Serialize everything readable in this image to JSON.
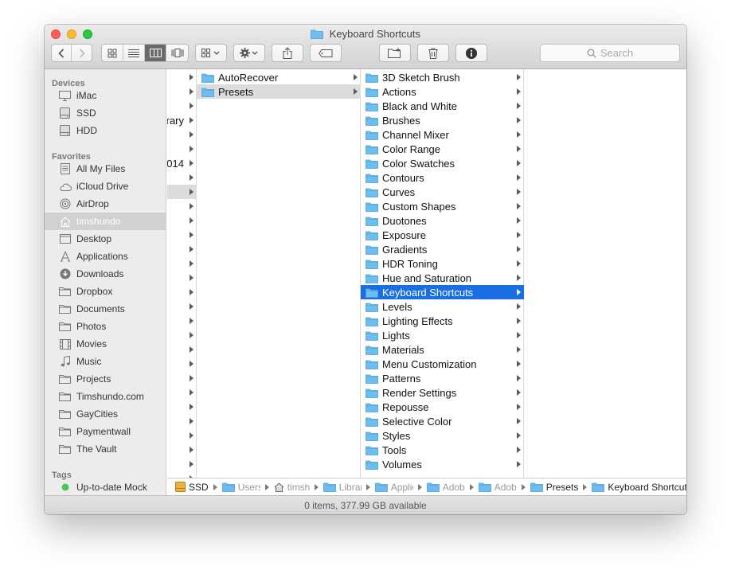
{
  "window": {
    "title": "Keyboard Shortcuts"
  },
  "toolbar": {
    "search_placeholder": "Search"
  },
  "sidebar": {
    "sections": [
      {
        "title": "Devices",
        "items": [
          {
            "label": "iMac",
            "icon": "imac-icon"
          },
          {
            "label": "SSD",
            "icon": "drive-icon"
          },
          {
            "label": "HDD",
            "icon": "drive-icon"
          }
        ]
      },
      {
        "title": "Favorites",
        "items": [
          {
            "label": "All My Files",
            "icon": "all-files-icon"
          },
          {
            "label": "iCloud Drive",
            "icon": "cloud-icon"
          },
          {
            "label": "AirDrop",
            "icon": "airdrop-icon"
          },
          {
            "label": "timshundo",
            "icon": "home-icon",
            "selected": true
          },
          {
            "label": "Desktop",
            "icon": "desktop-icon"
          },
          {
            "label": "Applications",
            "icon": "applications-icon"
          },
          {
            "label": "Downloads",
            "icon": "downloads-icon"
          },
          {
            "label": "Dropbox",
            "icon": "folder-icon"
          },
          {
            "label": "Documents",
            "icon": "folder-icon"
          },
          {
            "label": "Photos",
            "icon": "folder-icon"
          },
          {
            "label": "Movies",
            "icon": "movies-icon"
          },
          {
            "label": "Music",
            "icon": "music-icon"
          },
          {
            "label": "Projects",
            "icon": "folder-icon"
          },
          {
            "label": "Timshundo.com",
            "icon": "folder-icon"
          },
          {
            "label": "GayCities",
            "icon": "folder-icon"
          },
          {
            "label": "Paymentwall",
            "icon": "folder-icon"
          },
          {
            "label": "The Vault",
            "icon": "folder-icon"
          }
        ]
      },
      {
        "title": "Tags",
        "items": [
          {
            "label": "Up-to-date Mock",
            "icon": "green-tag-icon"
          }
        ]
      }
    ]
  },
  "columns": {
    "col0": [
      "",
      "",
      "",
      "rary",
      "",
      "",
      "014",
      "",
      "",
      "",
      "",
      "",
      "",
      "",
      "",
      "",
      "",
      "",
      "",
      "",
      "",
      "",
      "",
      "",
      "",
      "",
      "",
      "",
      ""
    ],
    "col1": [
      "AutoRecover",
      "Presets"
    ],
    "col2": [
      "3D Sketch Brush",
      "Actions",
      "Black and White",
      "Brushes",
      "Channel Mixer",
      "Color Range",
      "Color Swatches",
      "Contours",
      "Curves",
      "Custom Shapes",
      "Duotones",
      "Exposure",
      "Gradients",
      "HDR Toning",
      "Hue and Saturation",
      "Keyboard Shortcuts",
      "Levels",
      "Lighting Effects",
      "Lights",
      "Materials",
      "Menu Customization",
      "Patterns",
      "Render Settings",
      "Repousse",
      "Selective Color",
      "Styles",
      "Tools",
      "Volumes"
    ]
  },
  "pathbar": [
    {
      "label": "SSD",
      "icon": "drive-icon"
    },
    {
      "label": "Users",
      "icon": "folder-icon",
      "truncated": true
    },
    {
      "label": "timshundo",
      "icon": "home-icon",
      "truncated": true
    },
    {
      "label": "Library",
      "icon": "folder-icon",
      "truncated": true
    },
    {
      "label": "Application Support",
      "icon": "folder-icon",
      "truncated": true
    },
    {
      "label": "Adobe",
      "icon": "folder-icon",
      "truncated": true
    },
    {
      "label": "Adobe Photoshop",
      "icon": "folder-icon",
      "truncated": true
    },
    {
      "label": "Presets",
      "icon": "folder-icon"
    },
    {
      "label": "Keyboard Shortcuts",
      "icon": "folder-icon"
    }
  ],
  "status": "0 items, 377.99 GB available",
  "colors": {
    "selection": "#1a6ee3",
    "folder": "#6dbdf0"
  }
}
